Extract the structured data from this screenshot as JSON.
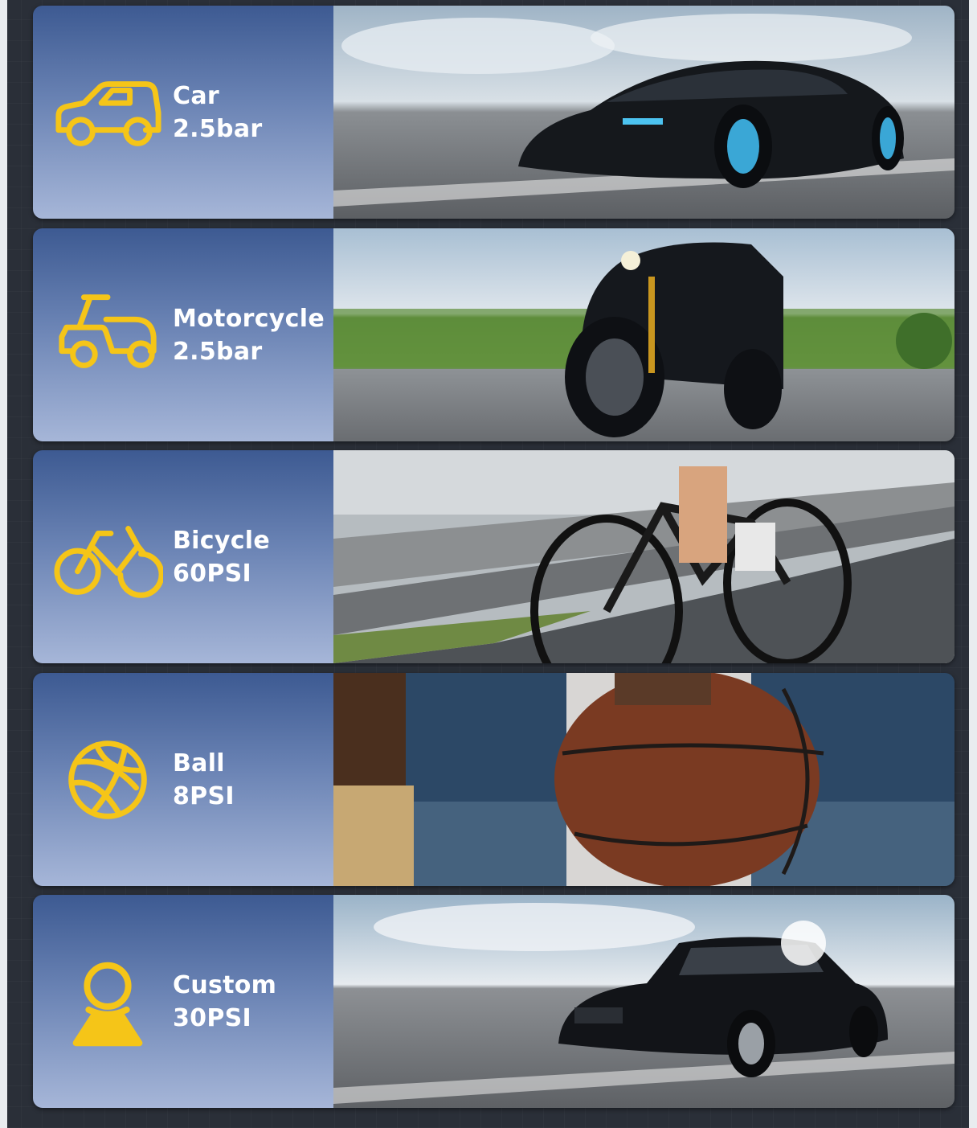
{
  "colors": {
    "accent": "#f5c518",
    "panel_top": "#3d5a92",
    "panel_bottom": "#a6b6d8",
    "text": "#ffffff"
  },
  "modes": [
    {
      "name": "Car",
      "pressure": "2.5bar",
      "icon": "car-icon",
      "photo": "sports-car-on-road"
    },
    {
      "name": "Motorcycle",
      "pressure": "2.5bar",
      "icon": "motorcycle-icon",
      "photo": "motorcycle-on-road"
    },
    {
      "name": "Bicycle",
      "pressure": "60PSI",
      "icon": "bicycle-icon",
      "photo": "cyclist-by-guardrail"
    },
    {
      "name": "Ball",
      "pressure": "8PSI",
      "icon": "ball-icon",
      "photo": "hand-holding-basketball"
    },
    {
      "name": "Custom",
      "pressure": "30PSI",
      "icon": "person-icon",
      "photo": "sedan-on-road"
    }
  ]
}
